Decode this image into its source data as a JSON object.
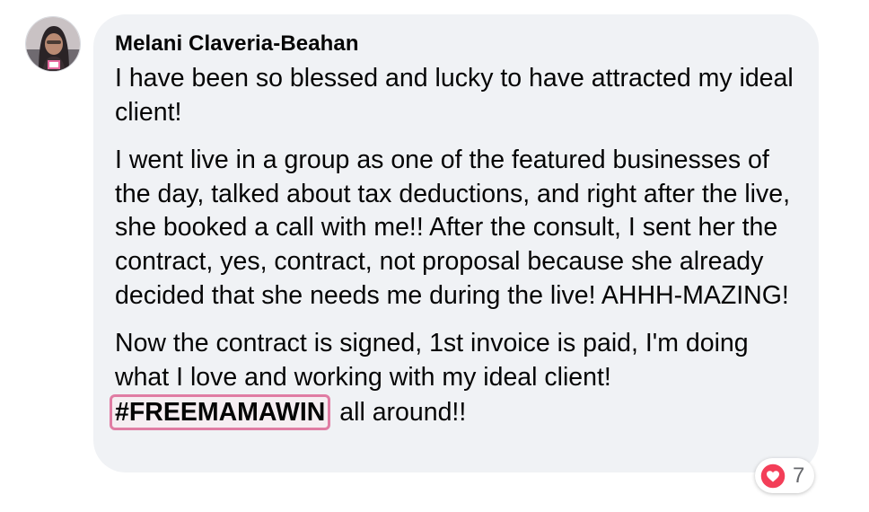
{
  "comment": {
    "author": "Melani Claveria-Beahan",
    "paragraphs": [
      "I have been so blessed and lucky to have attracted my ideal client!",
      "I went live in a group as one of the featured businesses of the day, talked about tax deductions, and right after the live, she booked a call with me!! After the consult, I sent her the contract, yes, contract, not proposal because she already decided that she needs me during the live! AHHH-MAZING!",
      "Now the contract is signed, 1st invoice is paid, I'm doing what I love and working with my ideal client!"
    ],
    "hashtag": "#FREEMAMAWIN",
    "after_hashtag": " all around!!",
    "reaction": {
      "icon": "heart-icon",
      "count": "7"
    }
  },
  "colors": {
    "bubble": "#f0f2f5",
    "text": "#050505",
    "hashtag_border": "#e07ca3",
    "heart": "#f33e58",
    "count": "#65676b"
  }
}
